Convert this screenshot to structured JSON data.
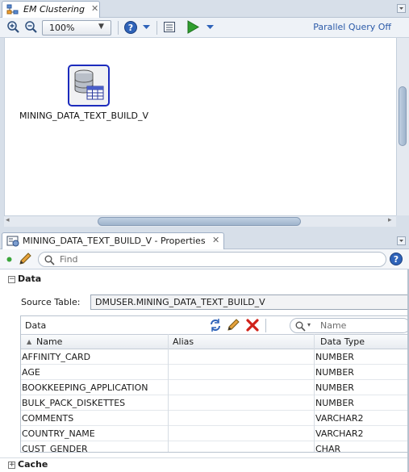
{
  "editor": {
    "tab_title": "EM Clustering",
    "icons": [
      "diagram-icon",
      "close-icon",
      "zoom-in-icon",
      "zoom-out-icon",
      "help-icon",
      "property-icon",
      "run-icon"
    ],
    "zoom": {
      "value": "100%"
    },
    "parallel_query_label": "Parallel Query Off",
    "node": {
      "label": "MINING_DATA_TEXT_BUILD_V",
      "icon": "data-source-table-icon",
      "selected_border_color": "#1c2bbd"
    }
  },
  "properties": {
    "tab_title": "MINING_DATA_TEXT_BUILD_V - Properties",
    "find_placeholder": "Find",
    "data_section": {
      "heading": "Data",
      "source_table_label": "Source Table:",
      "source_table_value": "DMUSER.MINING_DATA_TEXT_BUILD_V",
      "grid_title": "Data",
      "name_filter_placeholder": "Name",
      "columns": [
        "Name",
        "Alias",
        "Data Type"
      ],
      "rows": [
        {
          "name": "AFFINITY_CARD",
          "alias": "",
          "type": "NUMBER"
        },
        {
          "name": "AGE",
          "alias": "",
          "type": "NUMBER"
        },
        {
          "name": "BOOKKEEPING_APPLICATION",
          "alias": "",
          "type": "NUMBER"
        },
        {
          "name": "BULK_PACK_DISKETTES",
          "alias": "",
          "type": "NUMBER"
        },
        {
          "name": "COMMENTS",
          "alias": "",
          "type": "VARCHAR2"
        },
        {
          "name": "COUNTRY_NAME",
          "alias": "",
          "type": "VARCHAR2"
        },
        {
          "name": "CUST_GENDER",
          "alias": "",
          "type": "CHAR"
        }
      ]
    },
    "cache_section": {
      "heading": "Cache"
    }
  },
  "colors": {
    "accent_link": "#2b5aa8",
    "delete_red": "#d0221a",
    "run_green": "#2f9e2f",
    "chrome_bg": "#d7dfe9"
  }
}
